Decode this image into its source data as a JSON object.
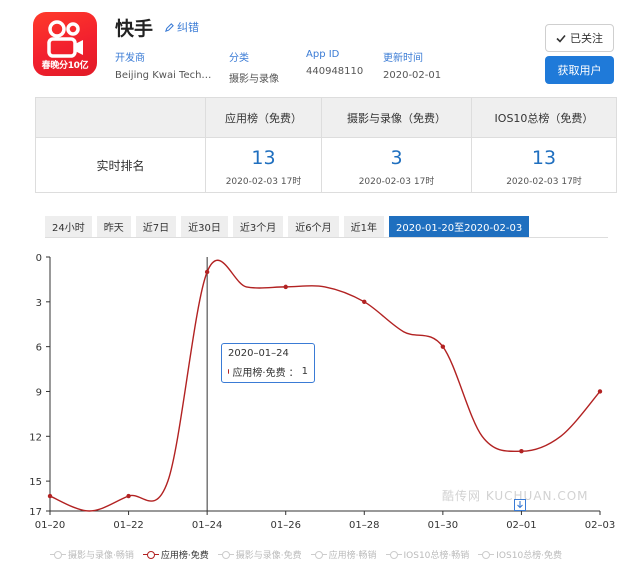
{
  "app": {
    "name": "快手",
    "icon_caption": "春晚分10亿",
    "report_label": "纠错",
    "meta": [
      {
        "key": "开发商",
        "value": "Beijing Kwai Tech…"
      },
      {
        "key": "分类",
        "value": "摄影与录像"
      },
      {
        "key": "App ID",
        "value": "440948110"
      },
      {
        "key": "更新时间",
        "value": "2020-02-01"
      }
    ],
    "follow_label": "已关注",
    "get_users_label": "获取用户"
  },
  "rank_table": {
    "row_label": "实时排名",
    "columns": [
      {
        "header": "应用榜（免费）",
        "rank": "13",
        "time": "2020-02-03 17时"
      },
      {
        "header": "摄影与录像（免费）",
        "rank": "3",
        "time": "2020-02-03 17时"
      },
      {
        "header": "IOS10总榜（免费）",
        "rank": "13",
        "time": "2020-02-03 17时"
      }
    ]
  },
  "tabs": [
    {
      "label": "24小时",
      "active": false
    },
    {
      "label": "昨天",
      "active": false
    },
    {
      "label": "近7日",
      "active": false
    },
    {
      "label": "近30日",
      "active": false
    },
    {
      "label": "近3个月",
      "active": false
    },
    {
      "label": "近6个月",
      "active": false
    },
    {
      "label": "近1年",
      "active": false
    },
    {
      "label": "2020-01-20至2020-02-03",
      "active": true
    }
  ],
  "tooltip": {
    "date": "2020–01–24",
    "series": "应用榜·免费",
    "value": "1"
  },
  "watermark": "酷传网 KUCHUAN.COM",
  "colors": {
    "accent": "#1f6fbf",
    "series": "#b22222",
    "inactive": "#cccccc"
  },
  "chart_data": {
    "type": "line",
    "x_tick_labels": [
      "01–20",
      "01–22",
      "01–24",
      "01–26",
      "01–28",
      "01–30",
      "02–01",
      "02–03"
    ],
    "y_tick_labels": [
      "0",
      "3",
      "6",
      "9",
      "12",
      "15",
      "17"
    ],
    "y_ticks": [
      0,
      3,
      6,
      9,
      12,
      15,
      17
    ],
    "ylim": [
      0,
      17
    ],
    "y_inverted": true,
    "grid": false,
    "legend_position": "bottom",
    "series": [
      {
        "name": "摄影与录像·畅销",
        "active": false,
        "points": []
      },
      {
        "name": "应用榜·免费",
        "active": true,
        "points": [
          {
            "x": "2020-01-20",
            "y": 16
          },
          {
            "x": "2020-01-21",
            "y": 17
          },
          {
            "x": "2020-01-22",
            "y": 16
          },
          {
            "x": "2020-01-23",
            "y": 15
          },
          {
            "x": "2020-01-24",
            "y": 1
          },
          {
            "x": "2020-01-25",
            "y": 2
          },
          {
            "x": "2020-01-26",
            "y": 2
          },
          {
            "x": "2020-01-27",
            "y": 2
          },
          {
            "x": "2020-01-28",
            "y": 3
          },
          {
            "x": "2020-01-29",
            "y": 5
          },
          {
            "x": "2020-01-30",
            "y": 6
          },
          {
            "x": "2020-01-31",
            "y": 12
          },
          {
            "x": "2020-02-01",
            "y": 13
          },
          {
            "x": "2020-02-02",
            "y": 12
          },
          {
            "x": "2020-02-03",
            "y": 9
          }
        ]
      },
      {
        "name": "摄影与录像·免费",
        "active": false,
        "points": []
      },
      {
        "name": "应用榜·畅销",
        "active": false,
        "points": []
      },
      {
        "name": "IOS10总榜·畅销",
        "active": false,
        "points": []
      },
      {
        "name": "IOS10总榜·免费",
        "active": false,
        "points": []
      }
    ]
  }
}
